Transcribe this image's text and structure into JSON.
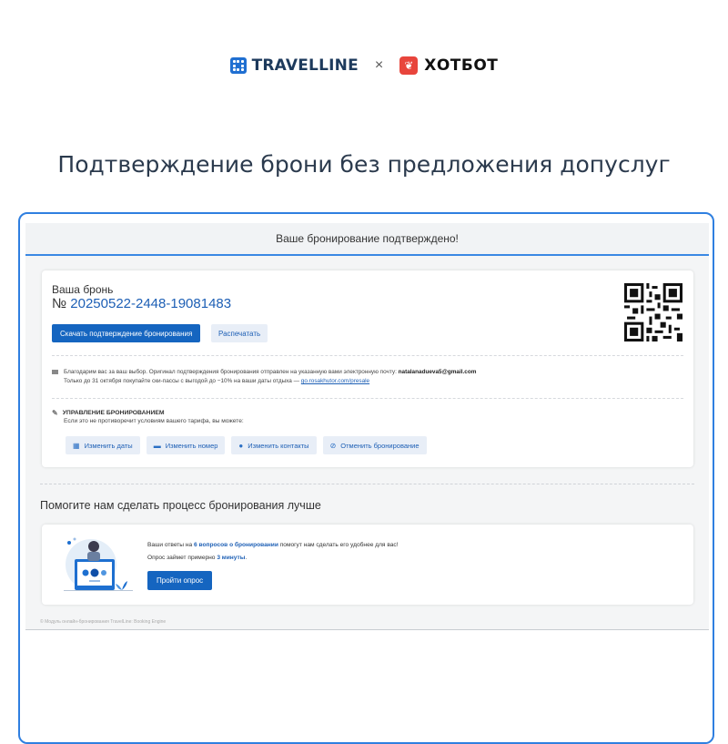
{
  "brands": {
    "left": "TRAVELLINE",
    "separator": "×",
    "right": "ХОТБОТ"
  },
  "headline": "Подтверждение брони без предложения допуслуг",
  "window": {
    "title": "Ваше бронирование подтверждено!"
  },
  "booking": {
    "label": "Ваша бронь",
    "number_prefix": "№",
    "number": "20250522-2448-19081483",
    "download_button": "Скачать подтверждение бронирования",
    "print_button": "Распечатать",
    "thanks_text": "Благодарим вас за ваш выбор. Оригинал подтверждения бронирования отправлен на указанную вами электронную почту:",
    "email": "natalanadueva5@gmail.com",
    "promo_text": "Только до 31 октября покупайте ски-пассы с выгодой до −10% на ваши даты отдыха —",
    "promo_link": "go.rosakhutor.com/presale"
  },
  "manage": {
    "title": "УПРАВЛЕНИЕ БРОНИРОВАНИЕМ",
    "subtitle": "Если это не противоречит условиям вашего тарифа, вы можете:",
    "actions": [
      {
        "label": "Изменить даты",
        "icon": "calendar-icon"
      },
      {
        "label": "Изменить номер",
        "icon": "bed-icon"
      },
      {
        "label": "Изменить контакты",
        "icon": "user-edit-icon"
      },
      {
        "label": "Отменить бронирование",
        "icon": "cancel-icon"
      }
    ]
  },
  "survey": {
    "heading": "Помогите нам сделать процесс бронирования лучше",
    "text1_pre": "Ваши ответы на",
    "text1_bold": "6 вопросов о бронировании",
    "text1_post": "помогут нам сделать его удобнее для вас!",
    "text2_pre": "Опрос займет примерно",
    "text2_bold": "3 минуты",
    "text2_post": ".",
    "button": "Пройти опрос"
  },
  "footer": "© Модуль онлайн-бронирования TravelLine: Booking Engine",
  "colors": {
    "accent": "#1565c0",
    "frame_border": "#2f7fe0",
    "link": "#1d5fb5"
  }
}
